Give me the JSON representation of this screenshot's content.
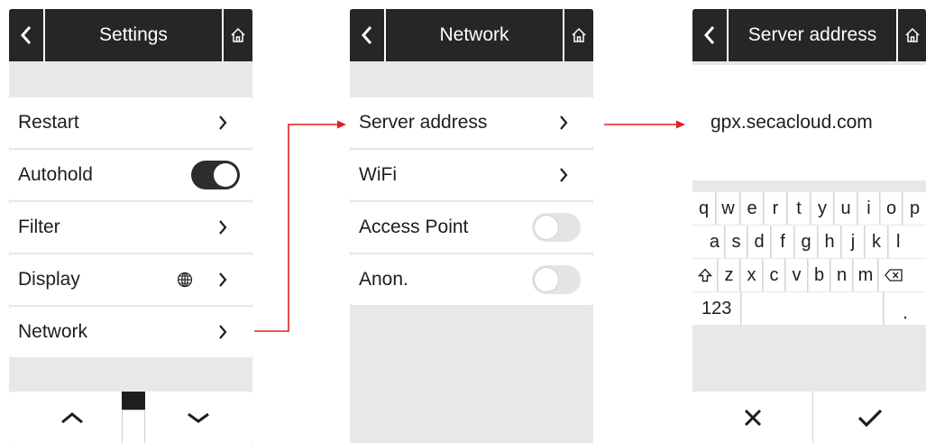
{
  "colors": {
    "header_bg": "#262626",
    "screen_bg": "#e8e8e8",
    "arrow": "#e02020",
    "toggle_on": "#2d2d2d"
  },
  "screens": [
    {
      "title": "Settings",
      "items": [
        {
          "label": "Restart",
          "control": "chevron"
        },
        {
          "label": "Autohold",
          "control": "toggle",
          "state": "on"
        },
        {
          "label": "Filter",
          "control": "chevron"
        },
        {
          "label": "Display",
          "control": "chevron",
          "icon": "globe-icon"
        },
        {
          "label": "Network",
          "control": "chevron"
        }
      ],
      "footer": {
        "up_icon": "chevron-up-icon",
        "down_icon": "chevron-down-icon"
      }
    },
    {
      "title": "Network",
      "items": [
        {
          "label": "Server address",
          "control": "chevron"
        },
        {
          "label": "WiFi",
          "control": "chevron"
        },
        {
          "label": "Access Point",
          "control": "toggle",
          "state": "off"
        },
        {
          "label": "Anon.",
          "control": "toggle",
          "state": "off"
        }
      ]
    },
    {
      "title": "Server address",
      "value": "gpx.secacloud.com",
      "keyboard": {
        "row1": [
          "q",
          "w",
          "e",
          "r",
          "t",
          "y",
          "u",
          "i",
          "o",
          "p"
        ],
        "row2": [
          "a",
          "s",
          "d",
          "f",
          "g",
          "h",
          "j",
          "k",
          "l"
        ],
        "row3": [
          "z",
          "x",
          "c",
          "v",
          "b",
          "n",
          "m"
        ],
        "mode_key": "123",
        "period_key": "."
      },
      "actions": {
        "cancel_icon": "close-icon",
        "confirm_icon": "check-icon"
      }
    }
  ]
}
